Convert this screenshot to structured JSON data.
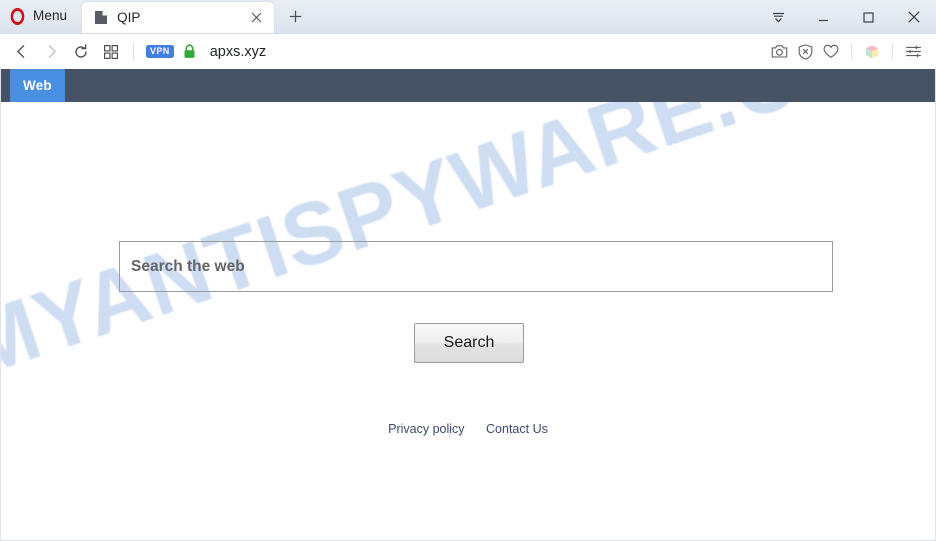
{
  "window": {
    "menu_label": "Menu",
    "controls": {
      "tab_menu": "tab-list-icon",
      "minimize": "minimize-icon",
      "maximize": "maximize-icon",
      "close": "close-icon"
    }
  },
  "tabs": [
    {
      "title": "QIP",
      "favicon": "page-icon",
      "active": true
    }
  ],
  "newtab_label": "+",
  "toolbar": {
    "back": "back-icon",
    "forward": "forward-icon",
    "reload": "reload-icon",
    "tiles": "speed-dial-icon",
    "vpn_badge": "VPN",
    "lock": "lock-icon",
    "url": "apxs.xyz",
    "right_icons": [
      "camera-icon",
      "ad-block-shield-icon",
      "heart-icon",
      "personalize-cube-icon",
      "easy-setup-sliders-icon"
    ]
  },
  "site": {
    "navbar": {
      "items": [
        {
          "label": "Web",
          "active": true
        }
      ]
    },
    "watermark": "MYANTISPYWARE.COM",
    "search": {
      "placeholder": "Search the web",
      "value": "",
      "button_label": "Search"
    },
    "footer": {
      "links": [
        {
          "label": "Privacy policy"
        },
        {
          "label": "Contact Us"
        }
      ]
    }
  },
  "colors": {
    "accent_blue": "#4a90e2",
    "navbar_dark": "#475364",
    "vpn_blue": "#3f7fe0",
    "lock_green": "#34a83a",
    "opera_red": "#cc0f16",
    "watermark_blue": "#c2d4f0",
    "footer_link": "#3b4a6b"
  }
}
